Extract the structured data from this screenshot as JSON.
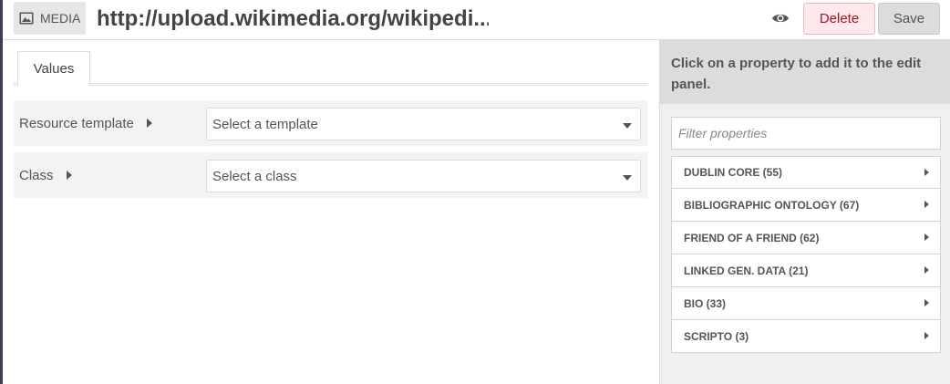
{
  "header": {
    "badge_label": "MEDIA",
    "badge_icon": "image-icon",
    "title": "http://upload.wikimedia.org/wikipedi...",
    "view_icon": "eye-icon",
    "delete_label": "Delete",
    "save_label": "Save"
  },
  "tabs": [
    {
      "label": "Values"
    }
  ],
  "fields": [
    {
      "label": "Resource template",
      "select_value": "Select a template"
    },
    {
      "label": "Class",
      "select_value": "Select a class"
    }
  ],
  "sidebar": {
    "instructions": "Click on a property to add it to the edit panel.",
    "filter_placeholder": "Filter properties",
    "vocabularies": [
      {
        "label": "DUBLIN CORE (55)"
      },
      {
        "label": "BIBLIOGRAPHIC ONTOLOGY (67)"
      },
      {
        "label": "FRIEND OF A FRIEND (62)"
      },
      {
        "label": "LINKED GEN. DATA (21)"
      },
      {
        "label": "BIO (33)"
      },
      {
        "label": "SCRIPTO (3)"
      }
    ]
  },
  "colors": {
    "delete_bg": "#fde9ec",
    "delete_text": "#a0152b",
    "save_bg": "#dcdcdc",
    "sidebar_bg": "#efefef"
  }
}
